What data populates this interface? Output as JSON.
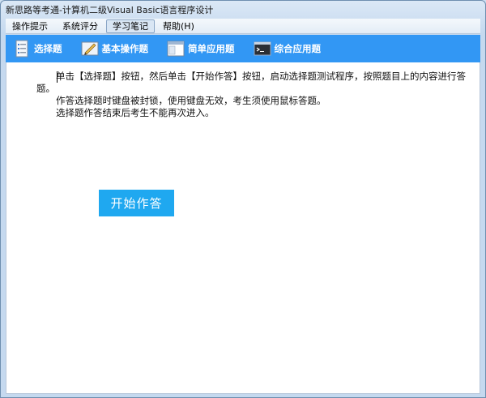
{
  "window": {
    "title": "新思路等考通-计算机二级Visual  Basic语言程序设计"
  },
  "menu": {
    "items": [
      {
        "label": "操作提示"
      },
      {
        "label": "系统评分"
      },
      {
        "label": "学习笔记"
      },
      {
        "label": "帮助(H)"
      }
    ],
    "active_index": 2
  },
  "toolbar": {
    "items": [
      {
        "label": "选择题",
        "icon": "document-list-icon"
      },
      {
        "label": "基本操作题",
        "icon": "pen-edit-icon"
      },
      {
        "label": "简单应用题",
        "icon": "window-form-icon"
      },
      {
        "label": "综合应用题",
        "icon": "console-icon"
      }
    ],
    "background_color": "#3297f4"
  },
  "main": {
    "paragraphs": [
      "单击【选择题】按钮，然后单击【开始作答】按钮，启动选择题测试程序，按照题目上的内容进行答题。",
      "作答选择题时键盘被封锁，使用键盘无效，考生须使用鼠标答题。",
      "选择题作答结束后考生不能再次进入。"
    ],
    "start_button_label": "开始作答",
    "start_button_color": "#1fa8f0"
  }
}
